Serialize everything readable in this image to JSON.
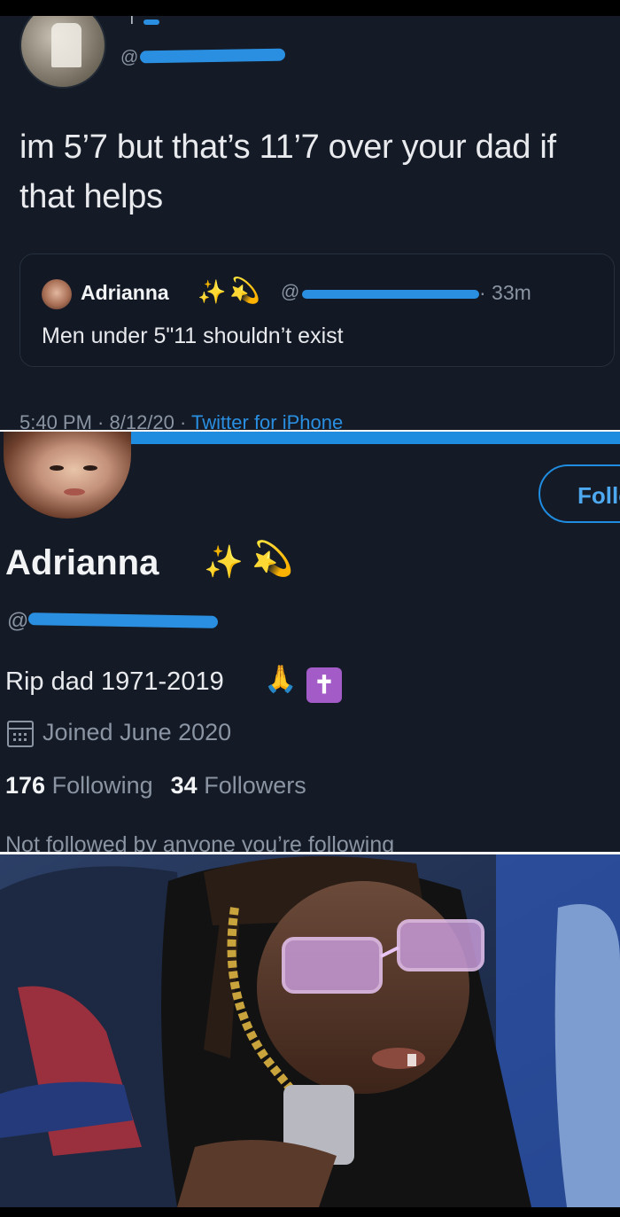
{
  "tweet": {
    "handle_prefix": "@",
    "top_glyph": "T",
    "text": "im 5’7 but that’s 11’7 over your dad if that helps",
    "quoted": {
      "name": "Adrianna",
      "emoji_1": "✨",
      "emoji_2": "💫",
      "handle_prefix": "@",
      "time": "· 33m",
      "text": "Men under 5\"11 shouldn’t exist"
    },
    "meta": {
      "time_date": "5:40 PM · 8/12/20 · ",
      "via": "Twitter for iPhone"
    }
  },
  "profile": {
    "follow_label": "Follow",
    "display_name": "Adrianna",
    "name_emoji_1": "✨",
    "name_emoji_2": "💫",
    "handle_prefix": "@",
    "bio": "Rip dad 1971-2019",
    "bio_emoji_pray": "🙏",
    "bio_emoji_cross": "✝",
    "joined": "Joined June 2020",
    "following_count": "176",
    "following_label": "Following",
    "followers_count": "34",
    "followers_label": "Followers",
    "not_followed": "Not followed by anyone you’re following"
  },
  "colors": {
    "background": "#141a26",
    "accent_blue": "#1f8ce0",
    "muted_text": "#8a94a2",
    "primary_text": "#e8eaed"
  }
}
